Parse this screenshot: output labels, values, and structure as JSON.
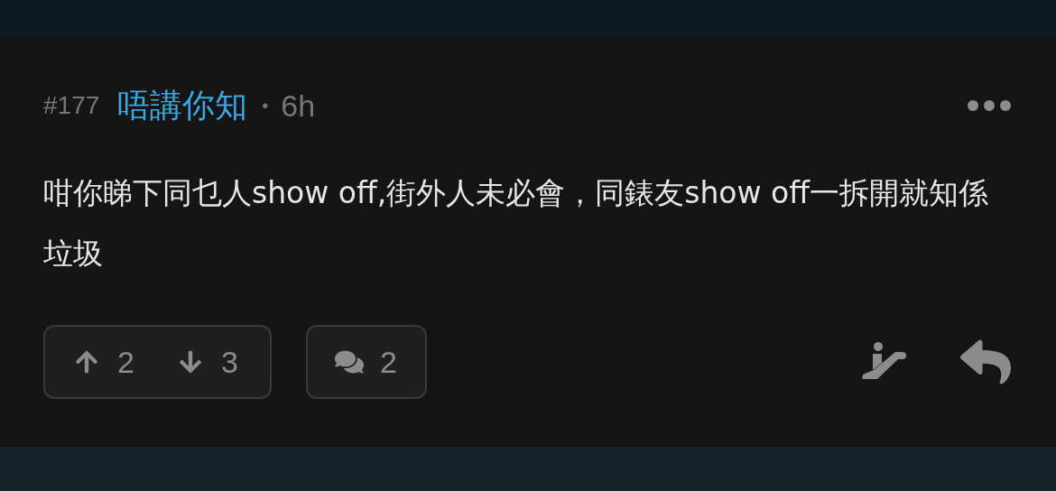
{
  "post": {
    "number": "#177",
    "author": "唔講你知",
    "separator": "•",
    "time": "6h",
    "body": "咁你睇下同乜人show off,街外人未必會，同錶友show off一拆開就知係垃圾"
  },
  "votes": {
    "up": "2",
    "down": "3"
  },
  "comments": {
    "count": "2"
  }
}
